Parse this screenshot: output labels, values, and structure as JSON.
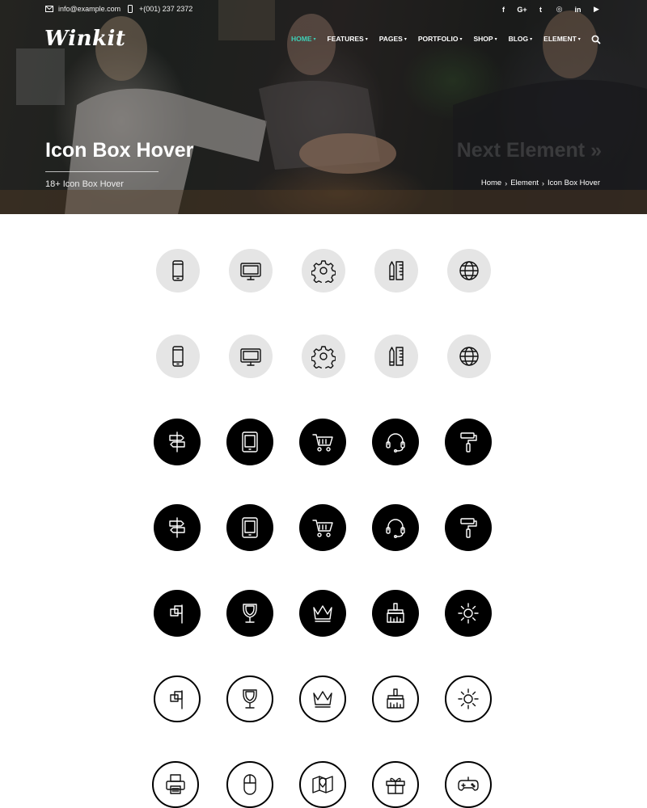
{
  "topbar": {
    "email": "info@example.com",
    "phone": "+(001) 237 2372",
    "social": [
      {
        "icon": "facebook-icon",
        "glyph": "f"
      },
      {
        "icon": "google-plus-icon",
        "glyph": "G+"
      },
      {
        "icon": "twitter-icon",
        "glyph": "t"
      },
      {
        "icon": "instagram-icon",
        "glyph": "◎"
      },
      {
        "icon": "linkedin-icon",
        "glyph": "in"
      },
      {
        "icon": "youtube-icon",
        "glyph": "▶"
      }
    ]
  },
  "brand": {
    "logo": "Winkit"
  },
  "nav": {
    "items": [
      {
        "label": "Home",
        "active": true
      },
      {
        "label": "Features",
        "active": false
      },
      {
        "label": "Pages",
        "active": false
      },
      {
        "label": "Portfolio",
        "active": false
      },
      {
        "label": "Shop",
        "active": false
      },
      {
        "label": "Blog",
        "active": false
      },
      {
        "label": "Element",
        "active": false
      }
    ],
    "search_icon": "search-icon"
  },
  "hero": {
    "title": "Icon Box Hover",
    "subtitle": "18+ Icon Box Hover",
    "next_label": "Next Element »",
    "breadcrumb": [
      "Home",
      "Element",
      "Icon Box Hover"
    ]
  },
  "colors": {
    "accent": "#3ecfb6",
    "dark_circle": "#000000",
    "light_circle": "#e5e5e5"
  },
  "icon_rows": [
    {
      "style": "light",
      "icons": [
        "smartphone-icon",
        "monitor-icon",
        "gear-icon",
        "pencil-ruler-icon",
        "globe-icon"
      ]
    },
    {
      "style": "light",
      "icons": [
        "smartphone-icon",
        "monitor-icon",
        "gear-icon",
        "pencil-ruler-icon",
        "globe-icon"
      ]
    },
    {
      "style": "dark",
      "icons": [
        "signpost-icon",
        "tablet-icon",
        "cart-icon",
        "headset-icon",
        "paint-roller-icon"
      ]
    },
    {
      "style": "dark",
      "icons": [
        "signpost-icon",
        "tablet-icon",
        "cart-icon",
        "headset-icon",
        "paint-roller-icon"
      ]
    },
    {
      "style": "dark",
      "icons": [
        "flags-icon",
        "trophy-icon",
        "crown-icon",
        "brush-icon",
        "sun-icon"
      ]
    },
    {
      "style": "outline",
      "icons": [
        "flags-icon",
        "trophy-icon",
        "crown-icon",
        "brush-icon",
        "sun-icon"
      ]
    },
    {
      "style": "outline",
      "icons": [
        "printer-icon",
        "mouse-icon",
        "map-icon",
        "gift-icon",
        "gamepad-icon"
      ]
    }
  ]
}
